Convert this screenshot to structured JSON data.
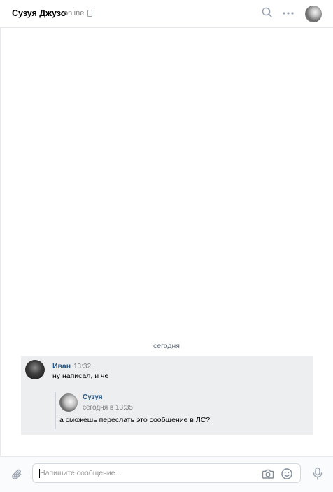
{
  "header": {
    "title": "Сузуя Джузо",
    "status": "online",
    "icons": [
      "search-icon",
      "more-icon",
      "phone-icon"
    ]
  },
  "chat": {
    "day_separator": "сегодня",
    "message": {
      "author": "Иван",
      "time": "13:32",
      "text": "ну написал, и че",
      "forwarded": {
        "author": "Сузуя",
        "time": "сегодня в 13:35",
        "text": "а сможешь переслать это сообщение в ЛС?"
      }
    }
  },
  "composer": {
    "placeholder": "Напишите сообщение...",
    "value": "",
    "icons": [
      "attach-icon",
      "camera-icon",
      "smile-icon",
      "mic-icon"
    ]
  },
  "colors": {
    "author_link": "#2a5885",
    "message_bg": "#edeef0",
    "muted_text": "#828282",
    "border": "#e7e8ec"
  }
}
